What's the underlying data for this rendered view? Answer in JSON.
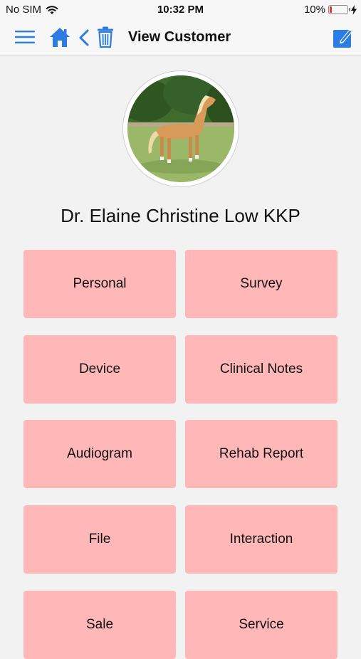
{
  "status_bar": {
    "carrier": "No SIM",
    "time": "10:32 PM",
    "battery_pct": "10%",
    "battery_level": 0.1
  },
  "nav": {
    "title": "View Customer"
  },
  "customer": {
    "name": "Dr. Elaine Christine Low KKP"
  },
  "tiles": [
    {
      "label": "Personal"
    },
    {
      "label": "Survey"
    },
    {
      "label": "Device"
    },
    {
      "label": "Clinical Notes"
    },
    {
      "label": "Audiogram"
    },
    {
      "label": "Rehab Report"
    },
    {
      "label": "File"
    },
    {
      "label": "Interaction"
    },
    {
      "label": "Sale"
    },
    {
      "label": "Service"
    }
  ],
  "colors": {
    "accent": "#2b7de1",
    "tile_bg": "#ffb7b7",
    "battery_low": "#e53935"
  },
  "icons": [
    "wifi-icon",
    "charging-bolt-icon",
    "menu-icon",
    "home-icon",
    "back-chevron-icon",
    "trash-icon",
    "edit-icon"
  ]
}
